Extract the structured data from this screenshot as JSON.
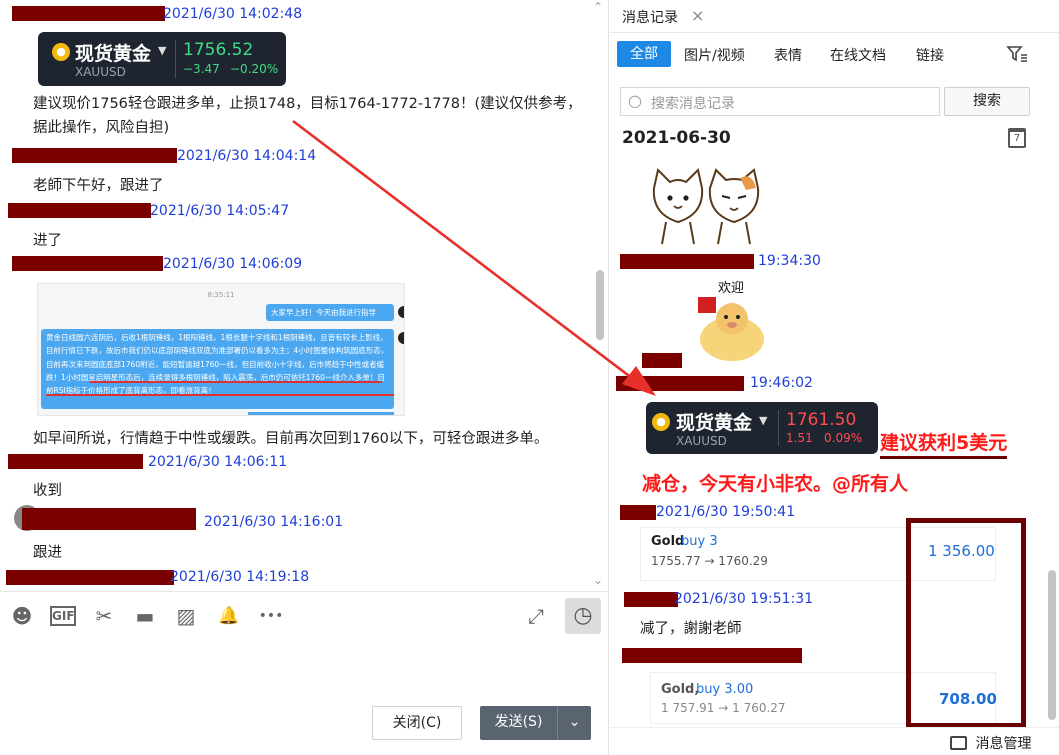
{
  "left": {
    "ts1": "2021/6/30 14:02:48",
    "card1": {
      "name": "现货黄金",
      "symbol": "XAUUSD",
      "price": "1756.52",
      "change": "−3.47",
      "change_pct": "−0.20%"
    },
    "msg1": "建议现价1756轻仓跟进多单，止损1748，目标1764-1772-1778！(建议仅供参考，据此操作，风险自担)",
    "ts2": "2021/6/30 14:04:14",
    "msg2": "老師下午好，跟进了",
    "ts3": "2021/6/30 14:05:47",
    "msg3": "进了",
    "ts4": "2021/6/30 14:06:09",
    "shot": {
      "time": "8:35:11",
      "greeting": "大家早上好！今天由我进行指导",
      "analysis": "黄金日线圆六连阴后，后收1根阴锤线，1根阳锤线，1根长腿十字线和1根阴锤线，且皆有较长上影线，目前行情已下跌，故后市我们仍以底部阴锤线双底为准部署仍以看多为主；4小时图整体构筑圆底形态，目前再次来到圆底底部1760附近，能短暂逾越1760一线，但目前收小十字线，后市将趋于中性或者缓跌！1小时圆呈启明星形态后，连续录得多根阴锤线，陷入震荡，后市仍可依托1760一线介入多单！目前RSI指标于价格形成了底背离形态，即看涨背离！"
    },
    "msg4": "如早间所说，行情趋于中性或缓跌。目前再次回到1760以下，可轻仓跟进多单。",
    "ts5": "2021/6/30 14:06:11",
    "msg5": "收到",
    "ts6": "2021/6/30 14:16:01",
    "msg6": "跟进",
    "ts7": "2021/6/30 14:19:18",
    "toolbar": {
      "emoji": "☻",
      "gif": "GIF",
      "cut": "✂",
      "folder": "▬",
      "image": "▨",
      "bell": "🔔",
      "more": "•••",
      "expand": "⤢",
      "history": "◷"
    },
    "close_label": "关闭(C)",
    "send_label": "发送(S)",
    "send_dropdown": "⌄"
  },
  "right": {
    "panel_title": "消息记录",
    "close_glyph": "×",
    "tabs": [
      "全部",
      "图片/视频",
      "表情",
      "在线文档",
      "链接"
    ],
    "search_placeholder": "搜索消息记录",
    "search_button": "搜索",
    "date": "2021-06-30",
    "calendar_day": "7",
    "ts1": "19:34:30",
    "welcome_text": "欢迎",
    "ts2": "19:46:02",
    "card2": {
      "name": "现货黄金",
      "symbol": "XAUUSD",
      "price": "1761.50",
      "change": "1.51",
      "change_pct": "0.09%"
    },
    "annot1": "建议获利5美元",
    "annot2": "减仓，今天有小非农。@所有人",
    "ts3": "2021/6/30 19:50:41",
    "trade1": {
      "asset": "Gold",
      "action": "buy 3",
      "prices": "1755.77 → 1760.29",
      "profit": "1 356.00"
    },
    "ts4": "2021/6/30 19:51:31",
    "msg1": "减了，謝謝老師",
    "trade2": {
      "asset": "Gold,",
      "action": "buy 3.00",
      "prices": "1 757.91 → 1 760.27",
      "profit": "708.00"
    },
    "footer_label": "消息管理"
  },
  "colors": {
    "timestamp": "#1f3fd8",
    "redaction": "#7a0000",
    "accent": "#1e88e5",
    "gold_up": "#3ddc84",
    "gold_down": "#ff4d4f",
    "annotation": "#ff1a1a",
    "annotation_box": "#6b0000"
  }
}
